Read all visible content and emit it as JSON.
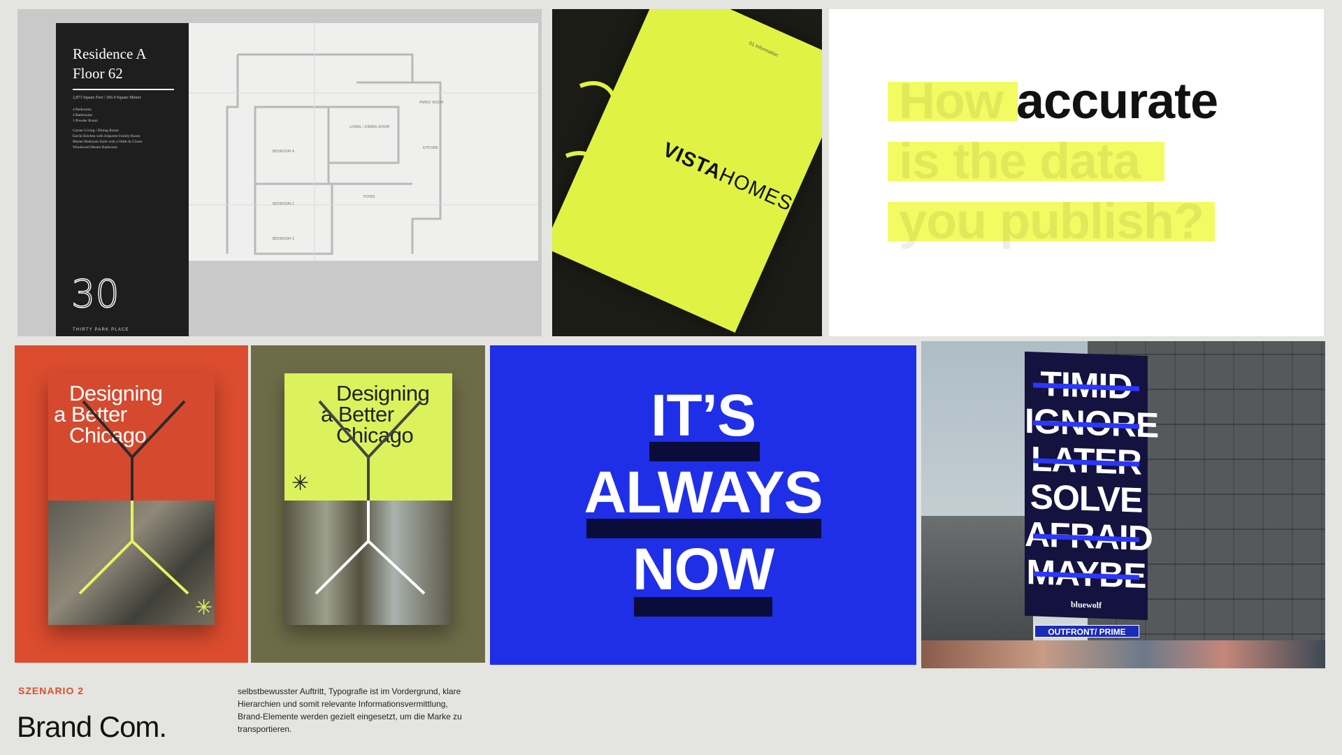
{
  "floorplan": {
    "title": "Residence A\nFloor 62",
    "subtitle": "2,873 Square Feet / 266.9 Square Meters",
    "features": [
      "4 Bedrooms",
      "4 Bathrooms",
      "1 Powder Room"
    ],
    "rooms": [
      "Corner Living / Dining Room",
      "Eat-In Kitchen with Adjacent Family Room",
      "Master Bedroom Suite with a Walk-In Closet",
      "Windowed Master Bathroom"
    ],
    "number": "30",
    "footer": "THIRTY PARK PLACE",
    "plan_labels": [
      "FAMILY ROOM",
      "LIVING / DINING ROOM",
      "KITCHEN",
      "BEDROOM 4",
      "BEDROOM 3",
      "BEDROOM 2",
      "FOYER"
    ]
  },
  "vista": {
    "cover_top": "01 Information",
    "brand_bold": "VISTA",
    "brand_light": "HOMES"
  },
  "accurate": {
    "line1_faded": "How",
    "line1_word": "accurate",
    "line2": "is the data",
    "line3": "you publish?"
  },
  "chicago": {
    "title_line1": "Designing",
    "title_line2": "a Better",
    "title_line3": "Chicago",
    "asterisk": "✳"
  },
  "now": {
    "word1": "IT’S",
    "word2": "ALWAYS",
    "word3": "NOW"
  },
  "billboard": {
    "words": [
      "TIMID",
      "IGNORE",
      "LATER",
      "SOLVE",
      "AFRAID",
      "MAYBE"
    ],
    "logo": "bluewolf",
    "banner": "OUTFRONT/ PRIME"
  },
  "footer": {
    "scenario": "SZENARIO 2",
    "brand": "Brand Com.",
    "description": "selbstbewusster Auftritt, Typografie ist im Vordergrund, klare Hierarchien und somit relevante Informationsvermittlung, Brand-Elemente werden gezielt eingesetzt, um die Marke zu transportieren."
  },
  "colors": {
    "accent_red": "#e04b2c",
    "blue": "#1f2fe8",
    "lime": "#e0f243",
    "navy": "#0a0c3a"
  }
}
